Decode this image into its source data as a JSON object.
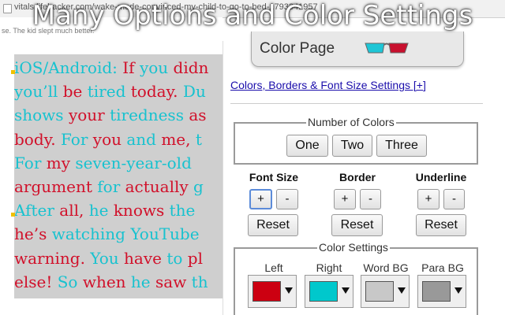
{
  "headline": "Many Options and Color Settings",
  "browser": {
    "url": "vitals.lifehacker.com/wake-mode-convinced-my-child-to-go-to-bed-1793341957"
  },
  "article": {
    "caption": "se. The kid slept much better.",
    "lines": [
      [
        {
          "t": "iOS/Android: ",
          "c": "cyan"
        },
        {
          "t": "If ",
          "c": "red"
        },
        {
          "t": "you ",
          "c": "cyan"
        },
        {
          "t": "didn",
          "c": "red"
        }
      ],
      [
        {
          "t": "you’ll ",
          "c": "cyan"
        },
        {
          "t": "be ",
          "c": "red"
        },
        {
          "t": "tired ",
          "c": "cyan"
        },
        {
          "t": "today. ",
          "c": "red"
        },
        {
          "t": "Du",
          "c": "cyan"
        }
      ],
      [
        {
          "t": "shows ",
          "c": "cyan"
        },
        {
          "t": "your ",
          "c": "red"
        },
        {
          "t": "tiredness ",
          "c": "cyan"
        },
        {
          "t": "as",
          "c": "red"
        }
      ],
      [
        {
          "t": "body. ",
          "c": "red"
        },
        {
          "t": "For ",
          "c": "cyan"
        },
        {
          "t": "you ",
          "c": "red"
        },
        {
          "t": "and ",
          "c": "cyan"
        },
        {
          "t": "me, ",
          "c": "red"
        },
        {
          "t": "t",
          "c": "cyan"
        }
      ],
      [
        {
          "t": "For ",
          "c": "cyan"
        },
        {
          "t": "my ",
          "c": "red"
        },
        {
          "t": "seven-year-old",
          "c": "cyan"
        }
      ],
      [
        {
          "t": "argument ",
          "c": "red"
        },
        {
          "t": "for ",
          "c": "cyan"
        },
        {
          "t": "actually ",
          "c": "red"
        },
        {
          "t": "g",
          "c": "cyan"
        }
      ],
      [
        {
          "t": "After ",
          "c": "cyan"
        },
        {
          "t": "all, ",
          "c": "red"
        },
        {
          "t": "he ",
          "c": "cyan"
        },
        {
          "t": "knows ",
          "c": "red"
        },
        {
          "t": "the ",
          "c": "cyan"
        },
        {
          "t": "",
          "c": "red"
        }
      ],
      [
        {
          "t": "he’s ",
          "c": "red"
        },
        {
          "t": "watching ",
          "c": "cyan"
        },
        {
          "t": "YouTube",
          "c": "cyan"
        }
      ],
      [
        {
          "t": "warning. ",
          "c": "red"
        },
        {
          "t": "You ",
          "c": "cyan"
        },
        {
          "t": "have ",
          "c": "red"
        },
        {
          "t": "to ",
          "c": "cyan"
        },
        {
          "t": "pl",
          "c": "red"
        }
      ],
      [
        {
          "t": "else! ",
          "c": "red"
        },
        {
          "t": "So ",
          "c": "cyan"
        },
        {
          "t": "when ",
          "c": "red"
        },
        {
          "t": "he ",
          "c": "cyan"
        },
        {
          "t": "saw ",
          "c": "red"
        },
        {
          "t": "th",
          "c": "cyan"
        }
      ]
    ]
  },
  "panel": {
    "tab_title": "Color Page",
    "settings_link": "Colors, Borders & Font Size Settings [+]",
    "num_colors": {
      "legend": "Number of Colors",
      "buttons": [
        "One",
        "Two",
        "Three"
      ]
    },
    "font_size": {
      "label": "Font Size",
      "plus": "+",
      "minus": "-",
      "reset": "Reset"
    },
    "border": {
      "label": "Border",
      "plus": "+",
      "minus": "-",
      "reset": "Reset"
    },
    "underline": {
      "label": "Underline",
      "plus": "+",
      "minus": "-",
      "reset": "Reset"
    },
    "color_settings": {
      "legend": "Color Settings",
      "pickers": [
        {
          "label": "Left",
          "color": "#cc0011"
        },
        {
          "label": "Right",
          "color": "#00c8cc"
        },
        {
          "label": "Word BG",
          "color": "#c8c8c8"
        },
        {
          "label": "Para BG",
          "color": "#999999"
        }
      ]
    }
  },
  "colors": {
    "red": "#d1102a",
    "cyan": "#17c2cf",
    "para_bg": "#cfcfcf"
  }
}
